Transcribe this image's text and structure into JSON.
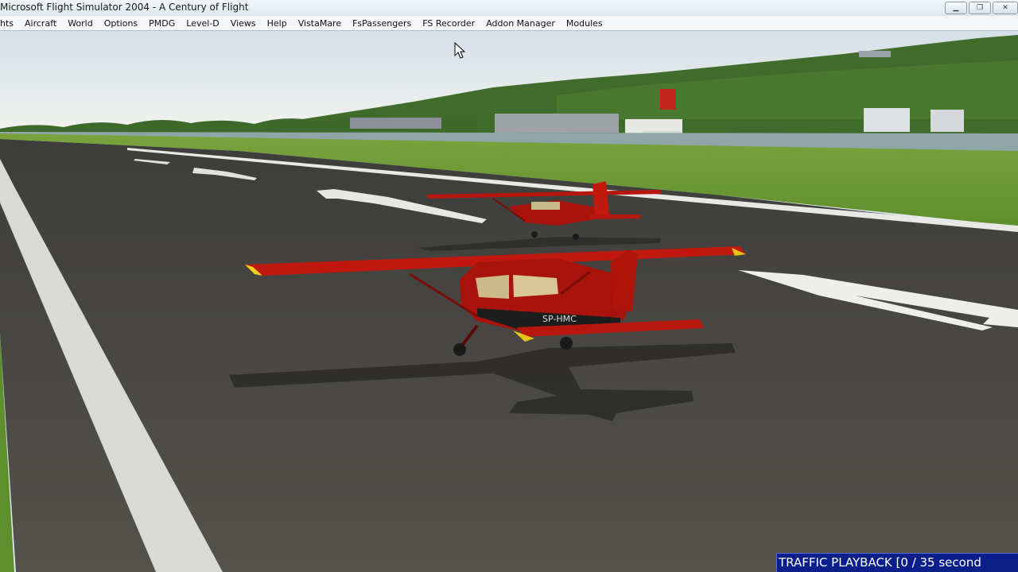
{
  "window": {
    "title": "Microsoft Flight Simulator 2004 - A Century of Flight",
    "buttons": [
      "minimize",
      "restore",
      "close"
    ]
  },
  "menu": {
    "items": [
      "hts",
      "Aircraft",
      "World",
      "Options",
      "PMDG",
      "Level-D",
      "Views",
      "Help",
      "VistaMare",
      "FsPassengers",
      "FS Recorder",
      "Addon Manager",
      "Modules"
    ]
  },
  "scene": {
    "aircraft": [
      {
        "type": "high-wing single-engine",
        "color": "#b8170f",
        "registration": "SP-HMC"
      },
      {
        "type": "high-wing single-engine",
        "color": "#b8170f"
      }
    ],
    "colors": {
      "sky_top": "#d9e2ea",
      "sky_horizon": "#f1f3ef",
      "runway": "#4a4a47",
      "grass": "#6f9a35",
      "hill": "#3f6b2b"
    }
  },
  "status": {
    "playback_text": "TRAFFIC PLAYBACK [0 / 35 second"
  }
}
